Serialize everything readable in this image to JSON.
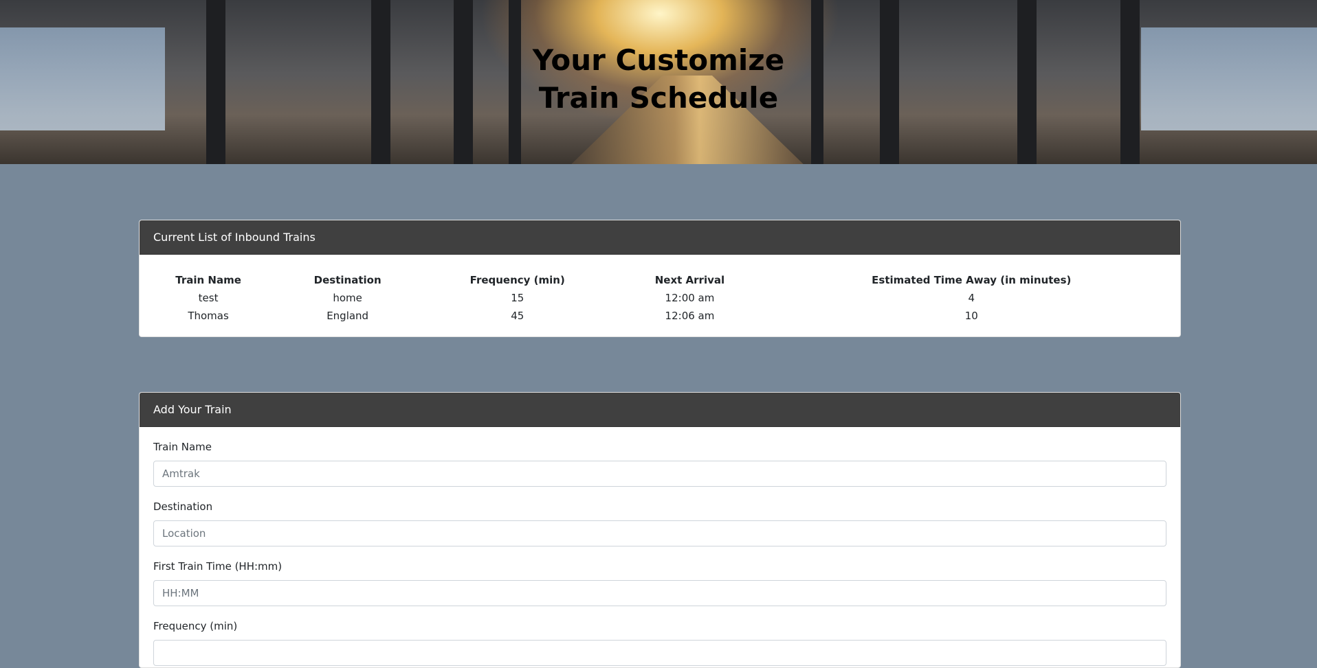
{
  "hero": {
    "title_line1": "Your Customize",
    "title_line2": "Train Schedule"
  },
  "schedule": {
    "header": "Current List of Inbound Trains",
    "columns": [
      "Train Name",
      "Destination",
      "Frequency (min)",
      "Next Arrival",
      "Estimated Time Away (in minutes)"
    ],
    "rows": [
      [
        "test",
        "home",
        "15",
        "12:00 am",
        "4"
      ],
      [
        "Thomas",
        "England",
        "45",
        "12:06 am",
        "10"
      ]
    ]
  },
  "form": {
    "header": "Add Your Train",
    "fields": [
      {
        "label": "Train Name",
        "placeholder": "Amtrak"
      },
      {
        "label": "Destination",
        "placeholder": "Location"
      },
      {
        "label": "First Train Time (HH:mm)",
        "placeholder": "HH:MM"
      },
      {
        "label": "Frequency (min)",
        "placeholder": ""
      }
    ]
  },
  "colors": {
    "background": "#778899",
    "card_header": "#404040"
  }
}
